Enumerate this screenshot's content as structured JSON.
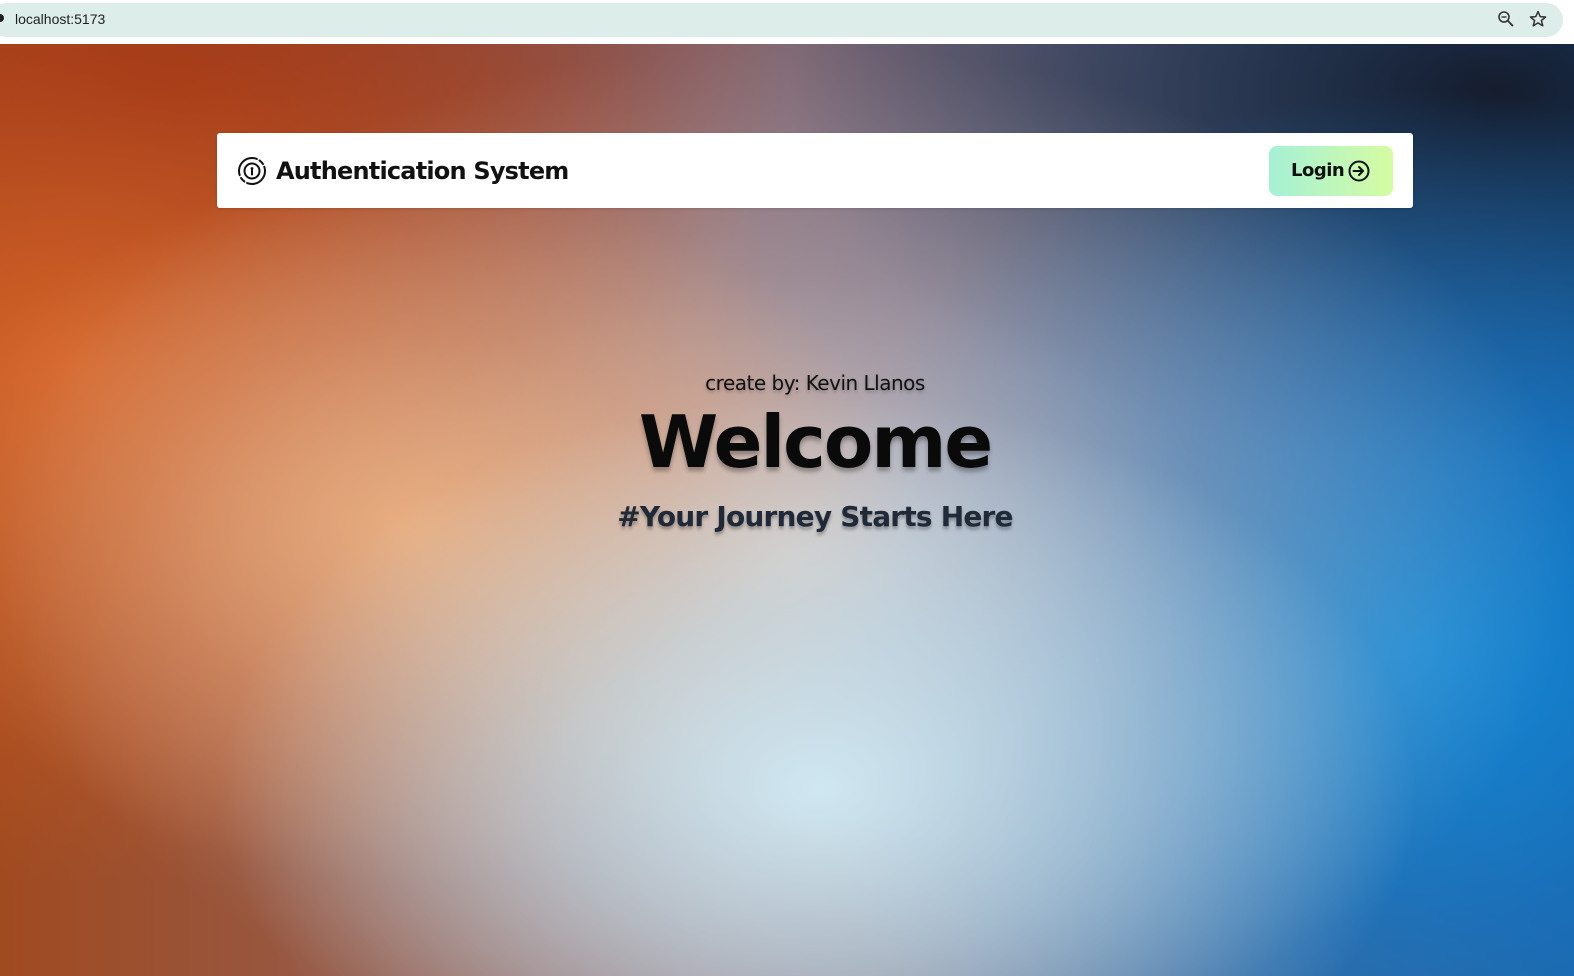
{
  "browser": {
    "url": "localhost:5173",
    "icons": [
      "site-info-icon",
      "zoom-icon",
      "bookmark-star-icon"
    ]
  },
  "navbar": {
    "brand_icon": "fingerprint-lock-icon",
    "title": "Authentication System",
    "login_label": "Login",
    "login_icon": "arrow-right-circle-icon",
    "login_gradient": [
      "#a5f0d6",
      "#d6fca2"
    ]
  },
  "hero": {
    "creator": "create by: Kevin Llanos",
    "title": "Welcome",
    "tagline": "#Your Journey Starts Here"
  },
  "colors": {
    "background_top_left": "#8a2a10",
    "background_left": "#d8742f",
    "background_center": "#e6cfc6",
    "background_bottom_center": "#cfe6f0",
    "background_right": "#1192dc",
    "background_top_right": "#141a28",
    "tagline": "#1f2937"
  }
}
